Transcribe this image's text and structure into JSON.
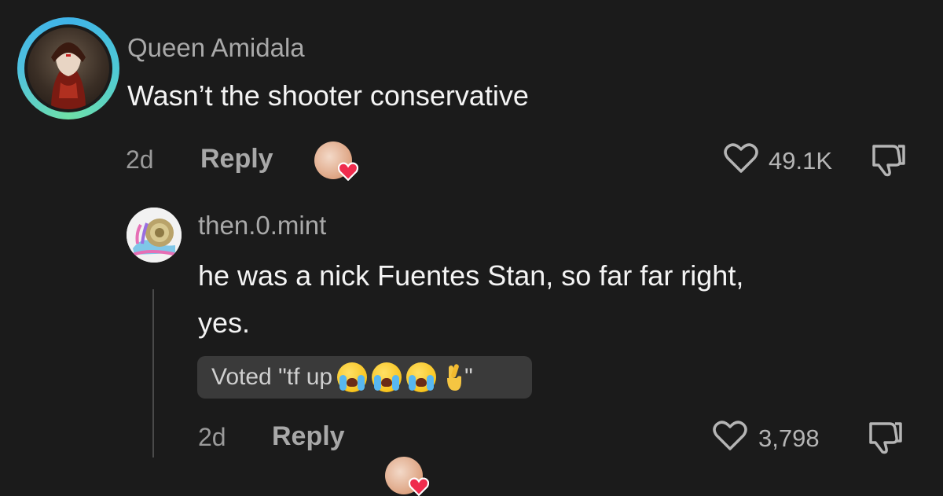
{
  "comment": {
    "username": "Queen Amidala",
    "text": "Wasn’t the shooter conservative",
    "age": "2d",
    "reply_label": "Reply",
    "likes": "49.1K"
  },
  "reply": {
    "username": "then.0.mint",
    "text_line1": "he was a nick Fuentes Stan, so far far right,",
    "text_line2": "yes.",
    "vote_prefix": "Voted \"tf up",
    "vote_suffix": " \"",
    "age": "2d",
    "reply_label": "Reply",
    "likes": "3,798"
  },
  "icons": {
    "like": "heart-outline-icon",
    "dislike": "thumbs-down-icon",
    "creator_liked": "creator-liked-sticker"
  },
  "colors": {
    "background": "#1b1b1b",
    "ring_gradient": [
      "#3fb3e8",
      "#6fe0a8"
    ],
    "heart_red": "#ef2c4d"
  }
}
